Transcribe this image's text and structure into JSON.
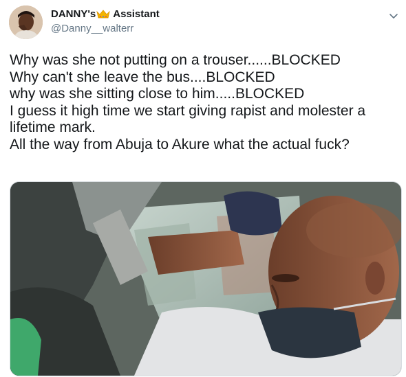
{
  "tweet": {
    "author_name": "DANNY's",
    "author_name_suffix": "Assistant",
    "author_handle": "@Danny__walterr",
    "text_lines": [
      "Why was she not putting on a trouser......BLOCKED",
      "Why can't she leave the bus....BLOCKED",
      "why was she sitting close to him.....BLOCKED",
      "I guess it high time we start giving rapist and molester a",
      "lifetime mark.",
      "All the way from Abuja to Akure what the actual fuck?"
    ]
  },
  "icons": {
    "crown": "crown-emoji",
    "menu": "chevron-down-icon"
  },
  "colors": {
    "primary_text": "#14171a",
    "secondary_text": "#657786",
    "crown": "#f4b400"
  }
}
